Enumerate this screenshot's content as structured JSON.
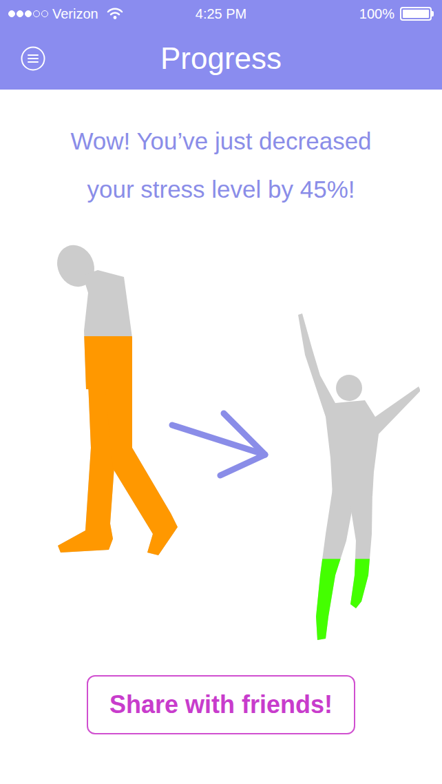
{
  "status_bar": {
    "carrier": "Verizon",
    "time": "4:25 PM",
    "battery": "100%",
    "battery_level": 1,
    "signal_level": 0.6
  },
  "header": {
    "title": "Progress"
  },
  "message": [
    "Wow! You’ve just decreased",
    "your stress level by 45%!"
  ],
  "figures": [
    {
      "kind": "before",
      "level": 0.7,
      "color": "#ff9800"
    },
    {
      "kind": "after",
      "level": 0.25,
      "color": "#44ff00"
    }
  ],
  "button": "Share with friends!"
}
